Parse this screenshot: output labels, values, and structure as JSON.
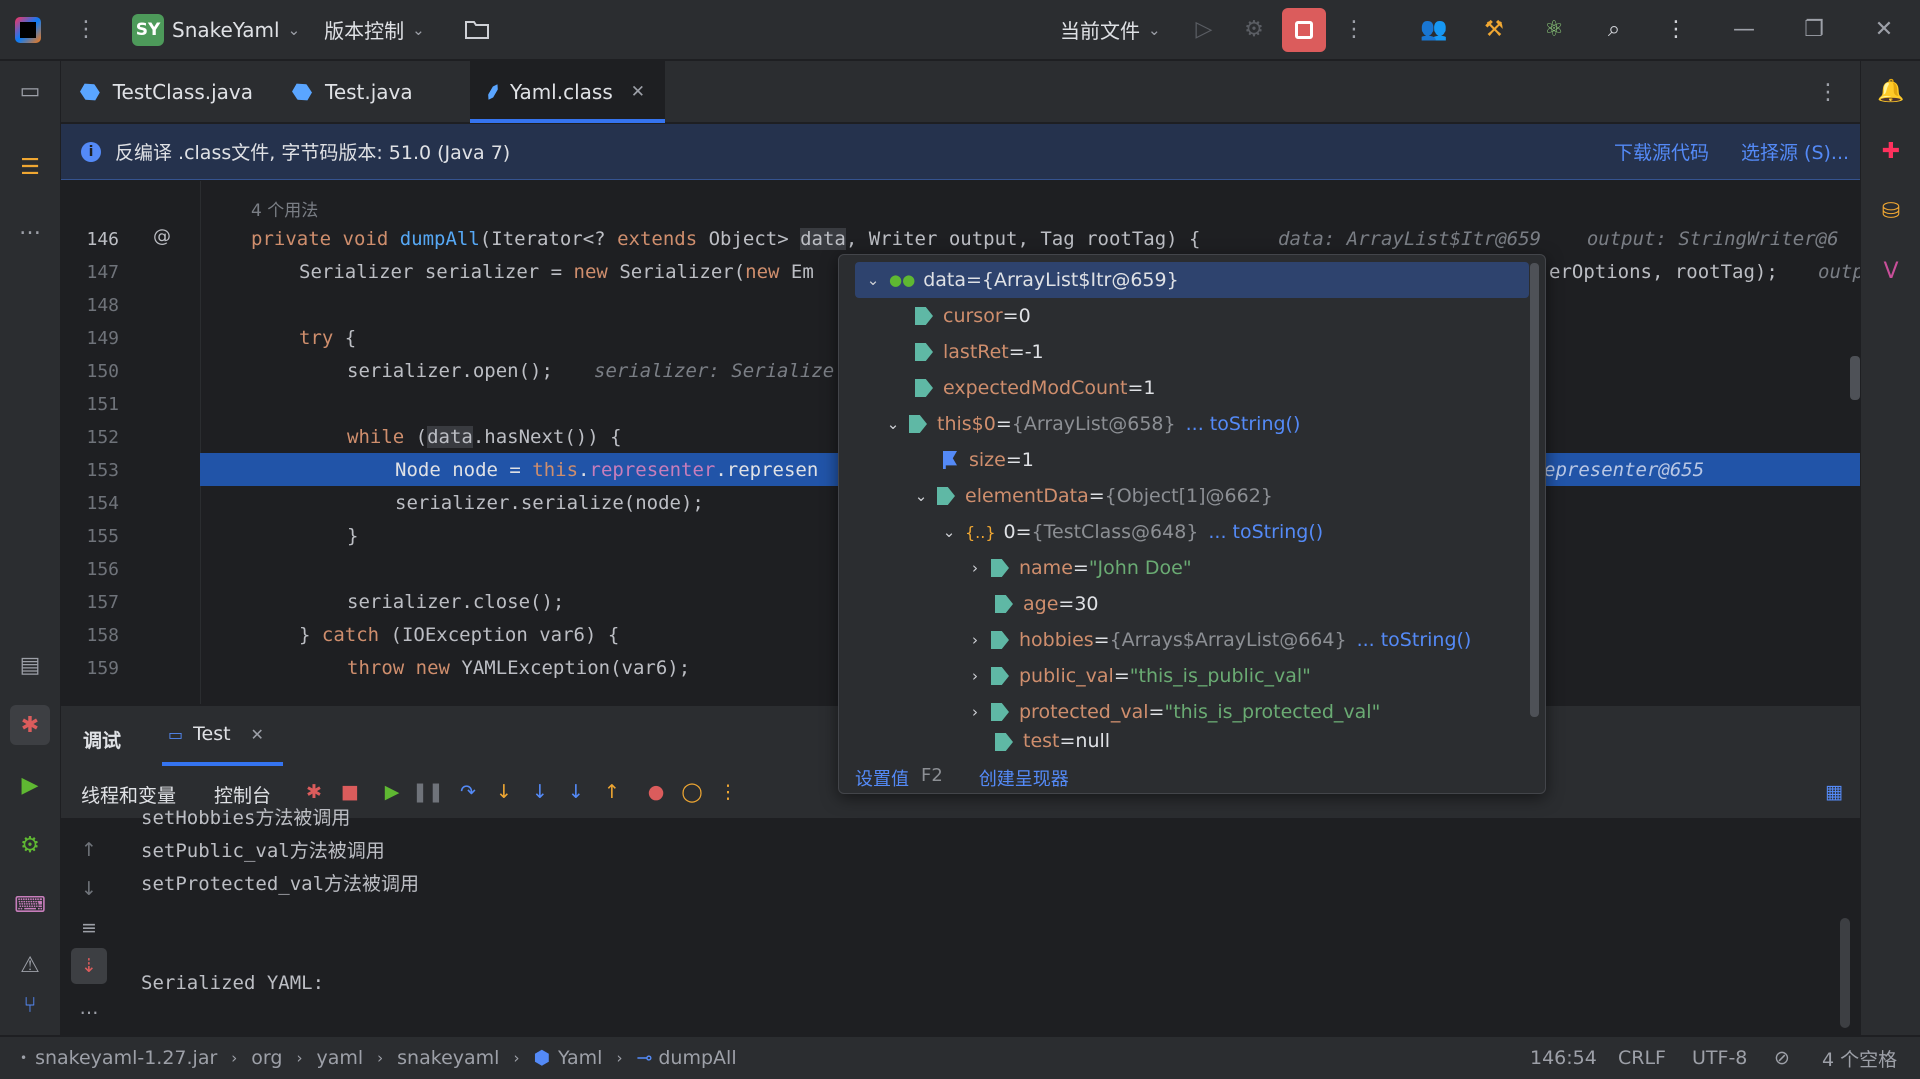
{
  "titlebar": {
    "project_initials": "SY",
    "project_name": "SnakeYaml",
    "vcs_label": "版本控制",
    "run_config": "当前文件"
  },
  "tabs": [
    {
      "label": "TestClass.java"
    },
    {
      "label": "Test.java"
    },
    {
      "label": "Yaml.class"
    }
  ],
  "banner": {
    "text": "反编译 .class文件, 字节码版本: 51.0 (Java 7)",
    "download_link": "下载源代码",
    "choose_link": "选择源 (S)..."
  },
  "editor": {
    "usages_hint": "4 个用法",
    "lines": [
      {
        "num": "146",
        "marker": "@"
      },
      {
        "num": "147"
      },
      {
        "num": "148"
      },
      {
        "num": "149"
      },
      {
        "num": "150"
      },
      {
        "num": "151"
      },
      {
        "num": "152"
      },
      {
        "num": "153"
      },
      {
        "num": "154"
      },
      {
        "num": "155"
      },
      {
        "num": "156"
      },
      {
        "num": "157"
      },
      {
        "num": "158"
      },
      {
        "num": "159"
      }
    ],
    "inline_hints": {
      "line146": "data: ArrayList$Itr@659    output: StringWriter@6",
      "line147_right": "erOptions, rootTag);",
      "line147_hint": "outp",
      "line150_hint": "serializer: Serialize",
      "line153_right": "epresenter@655"
    }
  },
  "popup": {
    "rows": [
      {
        "name": "data",
        "eq": " = ",
        "value": "{ArrayList$Itr@659}"
      },
      {
        "name": "cursor",
        "eq": " = ",
        "value": "0"
      },
      {
        "name": "lastRet",
        "eq": " = ",
        "value": "-1"
      },
      {
        "name": "expectedModCount",
        "eq": " = ",
        "value": "1"
      },
      {
        "name": "this$0",
        "eq": " = ",
        "value": "{ArrayList@658}",
        "link": "... toString()"
      },
      {
        "name": "size",
        "eq": " = ",
        "value": "1"
      },
      {
        "name": "elementData",
        "eq": " = ",
        "value": "{Object[1]@662}"
      },
      {
        "name": "0",
        "eq": " = ",
        "value": "{TestClass@648}",
        "link": "... toString()"
      },
      {
        "name": "name",
        "eq": " = ",
        "value": "\"John Doe\""
      },
      {
        "name": "age",
        "eq": " = ",
        "value": "30"
      },
      {
        "name": "hobbies",
        "eq": " = ",
        "value": "{Arrays$ArrayList@664}",
        "link": "... toString()"
      },
      {
        "name": "public_val",
        "eq": " = ",
        "value": "\"this_is_public_val\""
      },
      {
        "name": "protected_val",
        "eq": " = ",
        "value": "\"this_is_protected_val\""
      },
      {
        "name": "test",
        "eq": " = ",
        "value": "null"
      }
    ],
    "set_value": "设置值",
    "set_value_key": "F2",
    "create_renderer": "创建呈现器"
  },
  "debug": {
    "title": "调试",
    "session_tab": "Test",
    "threads_tab": "线程和变量",
    "console_tab": "控制台",
    "console_lines": [
      "setHobbies方法被调用",
      "setPublic_val方法被调用",
      "setProtected_val方法被调用",
      "",
      "",
      "Serialized YAML:"
    ]
  },
  "statusbar": {
    "crumbs": [
      "snakeyaml-1.27.jar",
      "org",
      "yaml",
      "snakeyaml",
      "Yaml",
      "dumpAll"
    ],
    "position": "146:54",
    "line_sep": "CRLF",
    "encoding": "UTF-8",
    "indent": "4 个空格"
  },
  "colors": {
    "accent": "#3574f0",
    "stop": "#db5c5c",
    "keyword": "#cf8e6d",
    "string": "#6aab73",
    "link": "#548af7"
  }
}
